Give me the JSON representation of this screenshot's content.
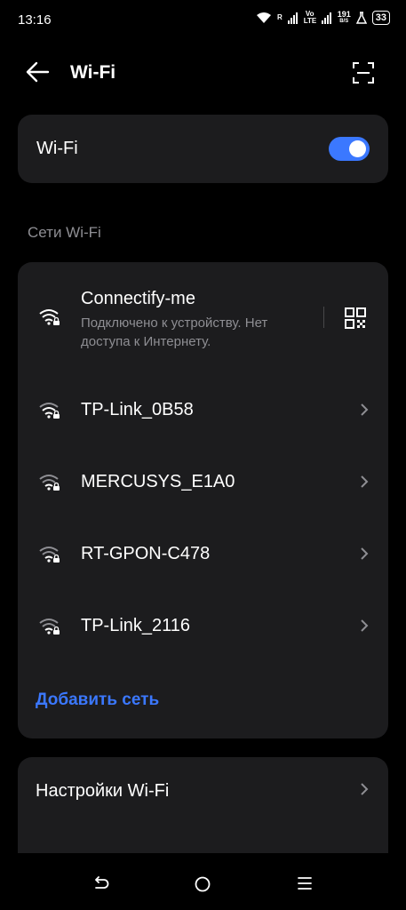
{
  "status_bar": {
    "time": "13:16",
    "sim1_label": "R",
    "volte_label": "Vo LTE",
    "speed_value": "191",
    "speed_unit": "B/S",
    "battery": "33"
  },
  "header": {
    "title": "Wi-Fi"
  },
  "wifi_toggle": {
    "label": "Wi-Fi",
    "on": true
  },
  "networks": {
    "section_title": "Сети Wi-Fi",
    "items": [
      {
        "name": "Connectify-me",
        "status": "Подключено к устройству. Нет доступа к Интернету."
      },
      {
        "name": "TP-Link_0B58"
      },
      {
        "name": "MERCUSYS_E1A0"
      },
      {
        "name": "RT-GPON-C478"
      },
      {
        "name": "TP-Link_2116"
      }
    ],
    "add_network": "Добавить сеть"
  },
  "settings": {
    "wifi_settings": "Настройки Wi-Fi"
  },
  "colors": {
    "accent": "#3b78ff",
    "card": "#1c1c1e",
    "secondary_text": "#8e8e93"
  }
}
